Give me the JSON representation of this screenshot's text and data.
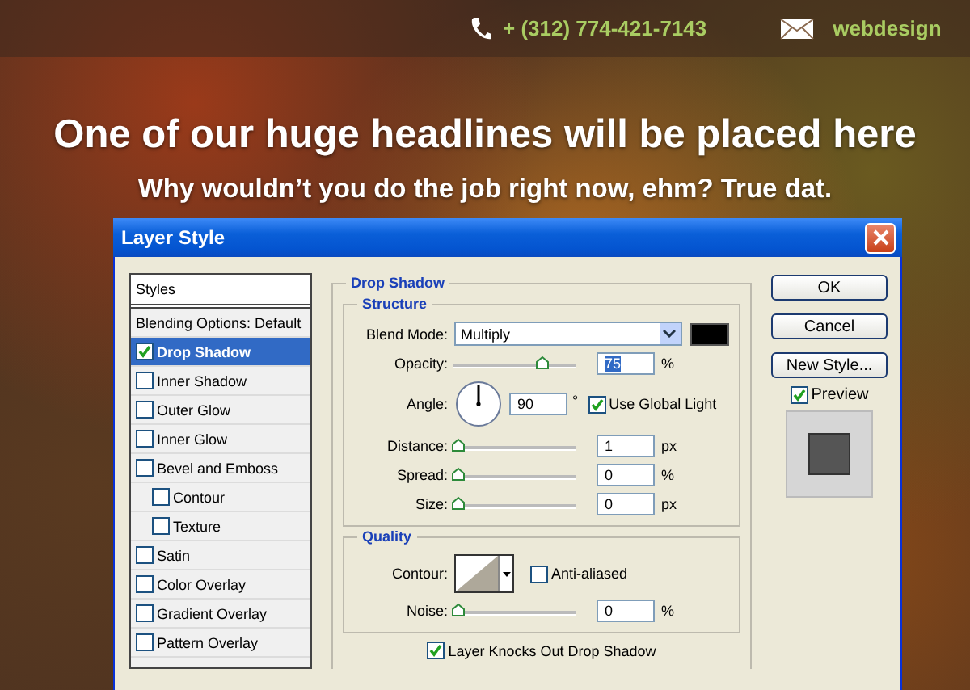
{
  "contact": {
    "phone": "+ (312) 774-421-7143",
    "email": "webdesign"
  },
  "headline": "One of our huge headlines will be placed here",
  "subheadline": "Why wouldn’t you do the job right now, ehm? True dat.",
  "dialog": {
    "title": "Layer Style",
    "styles_header": "Styles",
    "styles": [
      {
        "kind": "header",
        "label": "Blending Options: Default",
        "selected": false
      },
      {
        "kind": "effect",
        "label": "Drop Shadow",
        "checked": true,
        "selected": true
      },
      {
        "kind": "effect",
        "label": "Inner Shadow",
        "checked": false,
        "selected": false
      },
      {
        "kind": "effect",
        "label": "Outer Glow",
        "checked": false,
        "selected": false
      },
      {
        "kind": "effect",
        "label": "Inner Glow",
        "checked": false,
        "selected": false
      },
      {
        "kind": "effect",
        "label": "Bevel and Emboss",
        "checked": false,
        "selected": false,
        "children": [
          {
            "kind": "effect",
            "label": "Contour",
            "checked": false,
            "selected": false
          },
          {
            "kind": "effect",
            "label": "Texture",
            "checked": false,
            "selected": false
          }
        ]
      },
      {
        "kind": "effect",
        "label": "Satin",
        "checked": false,
        "selected": false
      },
      {
        "kind": "effect",
        "label": "Color Overlay",
        "checked": false,
        "selected": false
      },
      {
        "kind": "effect",
        "label": "Gradient Overlay",
        "checked": false,
        "selected": false
      },
      {
        "kind": "effect",
        "label": "Pattern Overlay",
        "checked": false,
        "selected": false
      }
    ],
    "section_title": "Drop Shadow",
    "structure": {
      "title": "Structure",
      "blend_mode": {
        "label": "Blend Mode:",
        "value": "Multiply"
      },
      "opacity": {
        "label": "Opacity:",
        "value": "75",
        "unit": "%",
        "level": 0.75
      },
      "angle": {
        "label": "Angle:",
        "value": "90",
        "unit": "°"
      },
      "use_global_light": {
        "label": "Use Global Light",
        "checked": true
      },
      "sliders": [
        {
          "label": "Distance:",
          "value": "1",
          "unit": "px",
          "level": 0
        },
        {
          "label": "Spread:",
          "value": "0",
          "unit": "%",
          "level": 0
        },
        {
          "label": "Size:",
          "value": "0",
          "unit": "px",
          "level": 0
        }
      ]
    },
    "quality": {
      "title": "Quality",
      "contour_label": "Contour:",
      "anti_aliased": {
        "label": "Anti-aliased",
        "checked": false
      },
      "noise": {
        "label": "Noise:",
        "value": "0",
        "unit": "%",
        "level": 0
      }
    },
    "knockout": {
      "label": "Layer Knocks Out Drop Shadow",
      "checked": true
    },
    "buttons": [
      "OK",
      "Cancel",
      "New Style..."
    ],
    "preview": {
      "label": "Preview",
      "checked": true
    }
  }
}
